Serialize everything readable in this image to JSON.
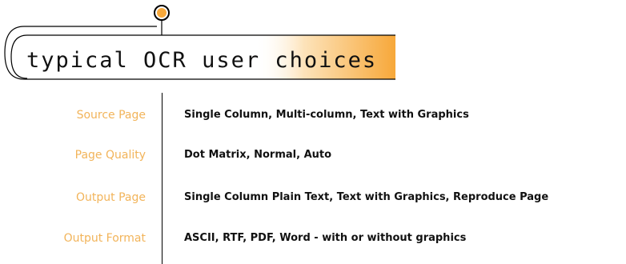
{
  "title": "typical OCR user choices",
  "colors": {
    "accent": "#f7a83a",
    "label": "#f2b45a",
    "text": "#111111"
  },
  "rows": [
    {
      "label": "Source Page",
      "value": "Single Column, Multi-column, Text with Graphics"
    },
    {
      "label": "Page Quality",
      "value": "Dot Matrix, Normal, Auto"
    },
    {
      "label": "Output Page",
      "value": "Single Column Plain Text, Text with Graphics, Reproduce Page"
    },
    {
      "label": "Output Format",
      "value": "ASCII, RTF, PDF, Word - with or without graphics"
    }
  ]
}
